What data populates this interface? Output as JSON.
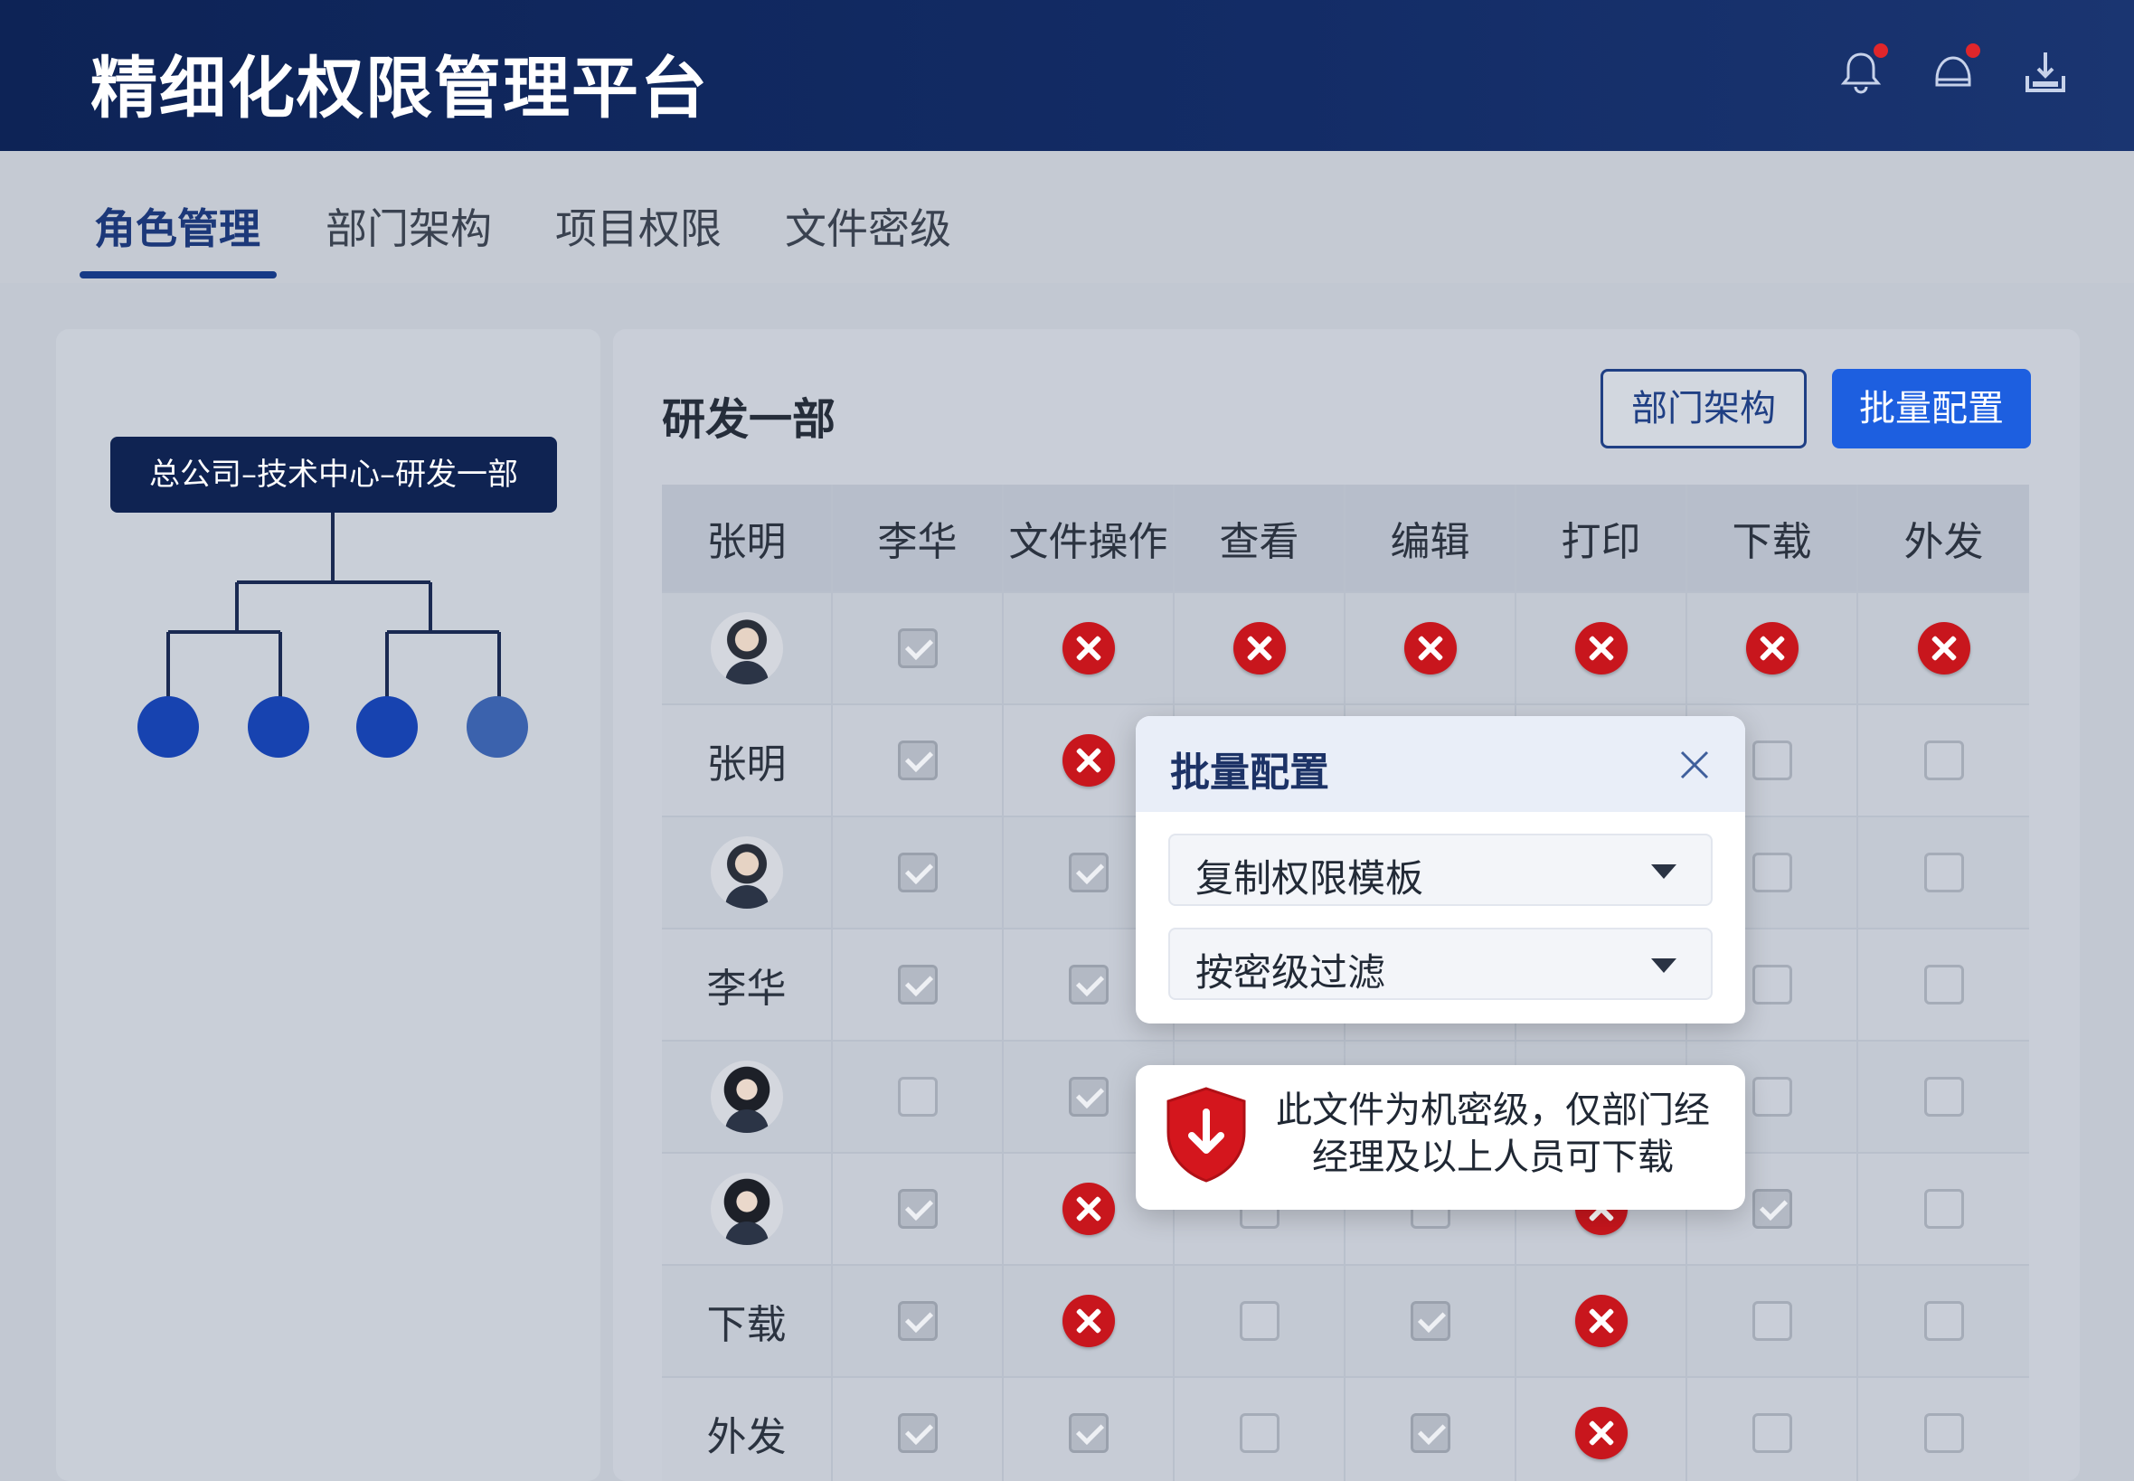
{
  "header": {
    "title": "精细化权限管理平台",
    "icons": [
      "bell-icon",
      "chat-icon",
      "download-icon"
    ],
    "accent": "#0d2356"
  },
  "tabs": [
    {
      "label": "角色管理",
      "active": true
    },
    {
      "label": "部门架构",
      "active": false
    },
    {
      "label": "项目权限",
      "active": false
    },
    {
      "label": "文件密级",
      "active": false
    }
  ],
  "org": {
    "path_label": "总公司–技术中心–研发一部"
  },
  "main": {
    "title": "研发一部",
    "btn_dept": "部门架构",
    "btn_batch": "批量配置",
    "primary_color": "#1d5fe0"
  },
  "grid": {
    "headers": [
      "张明",
      "李华",
      "文件操作",
      "查看",
      "编辑",
      "打印",
      "下载",
      "外发"
    ],
    "rows": [
      {
        "label": "",
        "avatar": "m",
        "cells": [
          "on",
          "x",
          "x",
          "x",
          "x",
          "x",
          "x"
        ]
      },
      {
        "label": "张明",
        "avatar": "",
        "cells": [
          "on",
          "x",
          "off",
          "off",
          "off",
          "off",
          "off"
        ]
      },
      {
        "label": "",
        "avatar": "m",
        "cells": [
          "on",
          "on",
          "off",
          "off",
          "off",
          "off",
          "off"
        ]
      },
      {
        "label": "李华",
        "avatar": "",
        "cells": [
          "on",
          "on",
          "off",
          "off",
          "off",
          "off",
          "off"
        ]
      },
      {
        "label": "",
        "avatar": "f",
        "cells": [
          "off",
          "on",
          "off",
          "off",
          "off",
          "off",
          "off"
        ]
      },
      {
        "label": "",
        "avatar": "f",
        "cells": [
          "on",
          "x",
          "off",
          "off",
          "x",
          "on",
          "off"
        ]
      },
      {
        "label": "下载",
        "avatar": "",
        "cells": [
          "on",
          "x",
          "off",
          "on",
          "x",
          "off",
          "off"
        ]
      },
      {
        "label": "外发",
        "avatar": "",
        "cells": [
          "on",
          "on",
          "off",
          "on",
          "x",
          "off",
          "off"
        ]
      }
    ]
  },
  "modal": {
    "title": "批量配置",
    "select1": "复制权限模板",
    "select2": "按密级过滤"
  },
  "alert": {
    "line1": "此文件为机密级，仅部门经",
    "line2": "经理及以上人员可下载",
    "color": "#d4161d"
  }
}
